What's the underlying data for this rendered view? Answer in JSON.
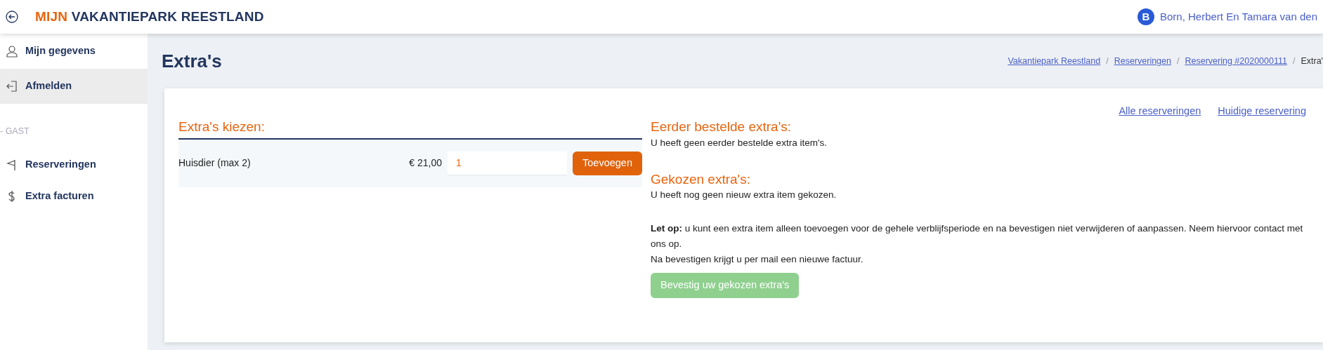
{
  "header": {
    "brand_accent": "MIJN",
    "brand": "VAKANTIEPARK REESTLAND",
    "user_initial": "B",
    "user_name": "Born, Herbert En Tamara van den"
  },
  "sidebar": {
    "items": [
      {
        "label": "Mijn gegevens",
        "selected": false
      },
      {
        "label": "Afmelden",
        "selected": true
      }
    ],
    "section_label": "- GAST",
    "section_items": [
      {
        "label": "Reserveringen",
        "selected": false
      },
      {
        "label": "Extra facturen",
        "selected": false
      }
    ]
  },
  "page_title": "Extra's",
  "breadcrumb": [
    {
      "label": "Vakantiepark Reestland",
      "link": true
    },
    {
      "separator": "/",
      "label": "Reserveringen",
      "link": true
    },
    {
      "separator": "/",
      "label": "Reservering #2020000111",
      "link": true
    },
    {
      "separator": "/",
      "label": "Extra'",
      "link": false
    }
  ],
  "top_links": [
    "Alle reserveringen",
    "Huidige reservering"
  ],
  "choose": {
    "title": "Extra's kiezen:",
    "items": [
      {
        "name": "Huisdier (max 2)",
        "price": "€ 21,00",
        "quantity": "1",
        "button": "Toevoegen"
      }
    ]
  },
  "ordered": {
    "title": "Eerder bestelde extra's:",
    "text": "U heeft geen eerder bestelde extra item's."
  },
  "chosen": {
    "title": "Gekozen extra's:",
    "text": "U heeft nog geen nieuw extra item gekozen."
  },
  "notice": [
    "**Let op:** u kunt een extra item alleen toevoegen voor de gehele verblijfsperiode en na bevestigen niet verwijderen of aanpassen. Neem hiervoor contact met ons op.",
    "Na bevestigen krijgt u per mail een nieuwe factuur."
  ],
  "confirm_button": {
    "label": "Bevestig uw gekozen extra's",
    "disabled": true
  }
}
